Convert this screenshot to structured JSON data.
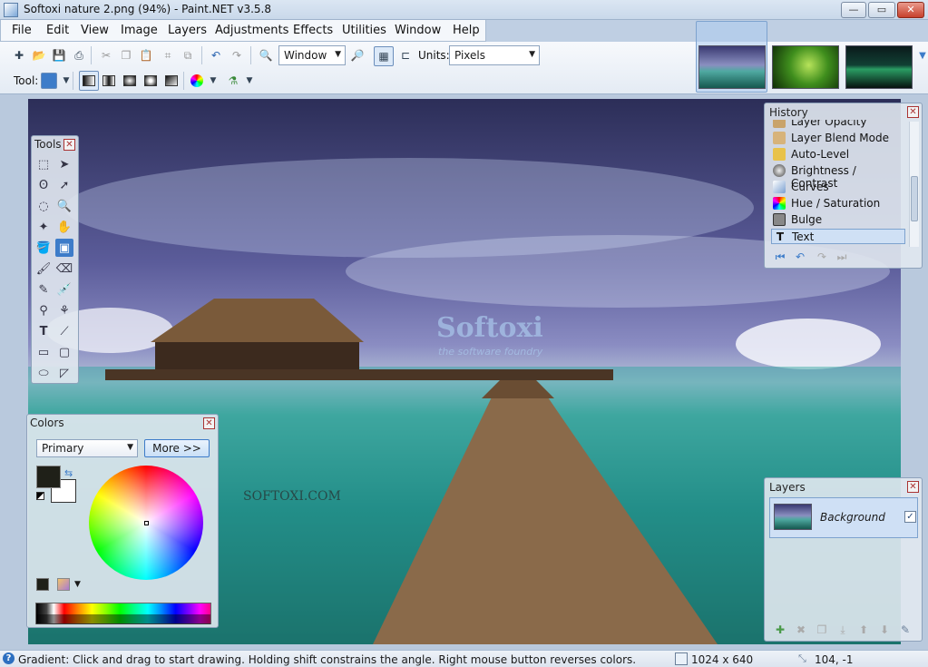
{
  "window": {
    "title": "Softoxi nature 2.png (94%) - Paint.NET v3.5.8",
    "minimize": "—",
    "maximize": "▭",
    "close": "✕"
  },
  "menu": [
    "File",
    "Edit",
    "View",
    "Image",
    "Layers",
    "Adjustments",
    "Effects",
    "Utilities",
    "Window",
    "Help"
  ],
  "toolbar": {
    "zoom_value": "Window",
    "units_label": "Units:",
    "units_value": "Pixels",
    "tool_label": "Tool:"
  },
  "tools_panel": {
    "title": "Tools",
    "close": "✕"
  },
  "history_panel": {
    "title": "History",
    "close": "✕",
    "items": [
      {
        "label": "Layer Opacity",
        "icon": "layer-opacity-icon"
      },
      {
        "label": "Layer Blend Mode",
        "icon": "blend-mode-icon"
      },
      {
        "label": "Auto-Level",
        "icon": "auto-level-icon"
      },
      {
        "label": "Brightness / Contrast",
        "icon": "brightness-contrast-icon"
      },
      {
        "label": "Curves",
        "icon": "curves-icon"
      },
      {
        "label": "Hue / Saturation",
        "icon": "hue-saturation-icon"
      },
      {
        "label": "Bulge",
        "icon": "bulge-icon"
      },
      {
        "label": "Text",
        "icon": "text-icon"
      }
    ]
  },
  "colors_panel": {
    "title": "Colors",
    "close": "✕",
    "mode": "Primary",
    "more_button": "More >>"
  },
  "layers_panel": {
    "title": "Layers",
    "close": "✕",
    "layer_name": "Background"
  },
  "canvas": {
    "watermark_brand": "Softoxi",
    "watermark_tagline": "the software foundry",
    "watermark_url": "SOFTOXI.COM"
  },
  "status": {
    "hint": "Gradient: Click and drag to start drawing. Holding shift constrains the angle. Right mouse button reverses colors.",
    "size": "1024 x 640",
    "coords": "104, -1"
  },
  "colors": {
    "accent": "#3d7cc9",
    "selection": "#cfe0f5"
  }
}
